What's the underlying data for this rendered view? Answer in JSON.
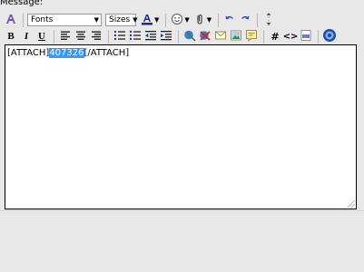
{
  "label": "Message:",
  "toolbar": {
    "fonts_value": "Fonts",
    "sizes_value": "Sizes",
    "bold_label": "B",
    "italic_label": "I",
    "underline_label": "U",
    "code_label": "#",
    "html_label": "<>",
    "accent_color": "#2b6fd6"
  },
  "editor": {
    "before": "[ATTACH]",
    "selected": "407326",
    "after": "[/ATTACH]"
  }
}
